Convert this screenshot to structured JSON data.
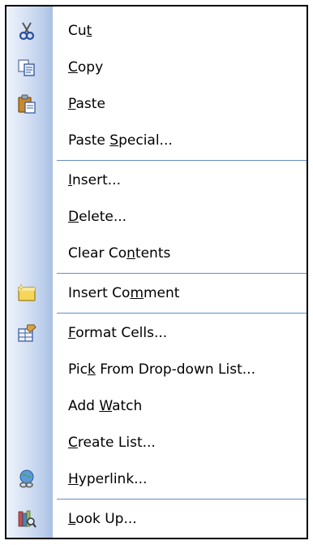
{
  "menu": {
    "items": [
      {
        "pre": "Cu",
        "acc": "t",
        "post": "",
        "icon": "cut-icon"
      },
      {
        "pre": "",
        "acc": "C",
        "post": "opy",
        "icon": "copy-icon"
      },
      {
        "pre": "",
        "acc": "P",
        "post": "aste",
        "icon": "paste-icon"
      },
      {
        "pre": "Paste ",
        "acc": "S",
        "post": "pecial...",
        "icon": ""
      },
      {
        "pre": "",
        "acc": "I",
        "post": "nsert...",
        "icon": ""
      },
      {
        "pre": "",
        "acc": "D",
        "post": "elete...",
        "icon": ""
      },
      {
        "pre": "Clear Co",
        "acc": "n",
        "post": "tents",
        "icon": ""
      },
      {
        "pre": "Insert Co",
        "acc": "m",
        "post": "ment",
        "icon": "insert-comment-icon"
      },
      {
        "pre": "",
        "acc": "F",
        "post": "ormat Cells...",
        "icon": "format-cells-icon"
      },
      {
        "pre": "Pic",
        "acc": "k",
        "post": " From Drop-down List...",
        "icon": ""
      },
      {
        "pre": "Add ",
        "acc": "W",
        "post": "atch",
        "icon": ""
      },
      {
        "pre": "",
        "acc": "C",
        "post": "reate List...",
        "icon": ""
      },
      {
        "pre": "",
        "acc": "H",
        "post": "yperlink...",
        "icon": "hyperlink-icon"
      },
      {
        "pre": "",
        "acc": "L",
        "post": "ook Up...",
        "icon": "lookup-icon"
      }
    ]
  }
}
